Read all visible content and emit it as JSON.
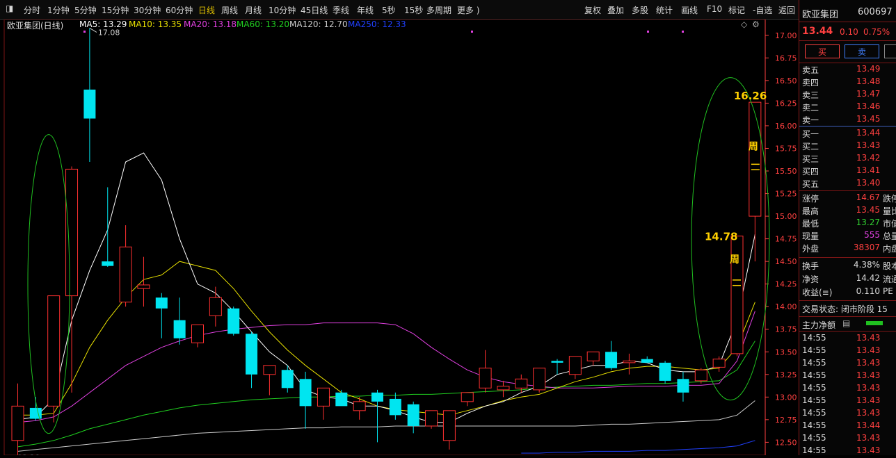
{
  "toolbar": {
    "periods": [
      "分时",
      "1分钟",
      "5分钟",
      "15分钟",
      "30分钟",
      "60分钟",
      "日线",
      "周线",
      "月线",
      "10分钟",
      "45日线",
      "季线",
      "年线",
      "5秒",
      "15秒",
      "多周期",
      "更多 )"
    ],
    "active": "日线",
    "tools": [
      "复权",
      "叠加",
      "多股",
      "统计",
      "画线",
      "F10",
      "标记",
      "-自选",
      "返回"
    ]
  },
  "chart_title": "欧亚集团(日线)",
  "ma_legend": [
    {
      "label": "MA5: 13.29",
      "color": "#ffffff"
    },
    {
      "label": "MA10: 13.35",
      "color": "#e8e000"
    },
    {
      "label": "MA20: 13.18",
      "color": "#e040e0"
    },
    {
      "label": "MA60: 13.20",
      "color": "#20d020"
    },
    {
      "label": "MA120: 12.70",
      "color": "#cccccc"
    },
    {
      "label": "MA250: 12.33",
      "color": "#2040ff"
    }
  ],
  "colors": {
    "up": "#ff3030",
    "down": "#00e5f0",
    "axis": "#ff4040",
    "ma5": "#ffffff",
    "ma10": "#e8e000",
    "ma20": "#e040e0",
    "ma60": "#20d020",
    "ma120": "#cccccc",
    "ma250": "#2040ff",
    "ellipse": "#20c020",
    "label": "#ffd000"
  },
  "chart_data": {
    "type": "candlestick",
    "title": "欧亚集团(日线)",
    "ylim": [
      12.38,
      17.16
    ],
    "yticks": [
      "17.00",
      "16.75",
      "16.50",
      "16.25",
      "16.00",
      "15.75",
      "15.50",
      "15.25",
      "15.00",
      "14.75",
      "14.50",
      "14.25",
      "14.00",
      "13.75",
      "13.50",
      "13.25",
      "13.00",
      "12.75",
      "12.50"
    ],
    "candles": [
      {
        "o": 12.52,
        "h": 13.15,
        "l": 12.36,
        "c": 12.9
      },
      {
        "o": 12.88,
        "h": 13.0,
        "l": 12.74,
        "c": 12.76
      },
      {
        "o": 12.9,
        "h": 13.0,
        "l": 12.72,
        "c": 14.12
      },
      {
        "o": 14.12,
        "h": 15.55,
        "l": 13.05,
        "c": 15.52
      },
      {
        "o": 16.4,
        "h": 17.08,
        "l": 15.6,
        "c": 16.08
      },
      {
        "o": 14.5,
        "h": 15.32,
        "l": 14.44,
        "c": 14.45
      },
      {
        "o": 14.05,
        "h": 14.9,
        "l": 14.0,
        "c": 14.66
      },
      {
        "o": 14.2,
        "h": 14.55,
        "l": 14.0,
        "c": 14.24
      },
      {
        "o": 14.1,
        "h": 14.15,
        "l": 13.65,
        "c": 13.98
      },
      {
        "o": 13.85,
        "h": 14.1,
        "l": 13.58,
        "c": 13.65
      },
      {
        "o": 13.6,
        "h": 13.8,
        "l": 13.55,
        "c": 13.8
      },
      {
        "o": 13.9,
        "h": 14.22,
        "l": 13.78,
        "c": 14.1
      },
      {
        "o": 13.98,
        "h": 14.0,
        "l": 13.68,
        "c": 13.7
      },
      {
        "o": 13.7,
        "h": 13.72,
        "l": 13.1,
        "c": 13.25
      },
      {
        "o": 13.25,
        "h": 13.3,
        "l": 13.02,
        "c": 13.35
      },
      {
        "o": 13.3,
        "h": 13.35,
        "l": 13.05,
        "c": 13.1
      },
      {
        "o": 13.2,
        "h": 13.28,
        "l": 12.65,
        "c": 12.9
      },
      {
        "o": 12.9,
        "h": 13.1,
        "l": 12.75,
        "c": 13.1
      },
      {
        "o": 13.05,
        "h": 13.08,
        "l": 12.92,
        "c": 12.9
      },
      {
        "o": 12.85,
        "h": 13.0,
        "l": 12.75,
        "c": 12.95
      },
      {
        "o": 13.05,
        "h": 13.08,
        "l": 12.5,
        "c": 12.95
      },
      {
        "o": 12.98,
        "h": 13.05,
        "l": 12.75,
        "c": 12.8
      },
      {
        "o": 12.92,
        "h": 12.95,
        "l": 12.6,
        "c": 12.68
      },
      {
        "o": 12.68,
        "h": 12.85,
        "l": 12.65,
        "c": 12.85
      },
      {
        "o": 12.52,
        "h": 12.85,
        "l": 12.42,
        "c": 12.85
      },
      {
        "o": 12.95,
        "h": 13.05,
        "l": 12.9,
        "c": 13.05
      },
      {
        "o": 13.1,
        "h": 13.52,
        "l": 13.05,
        "c": 13.32
      },
      {
        "o": 13.08,
        "h": 13.18,
        "l": 13.0,
        "c": 13.12
      },
      {
        "o": 13.1,
        "h": 13.25,
        "l": 13.05,
        "c": 13.2
      },
      {
        "o": 13.08,
        "h": 13.3,
        "l": 13.05,
        "c": 13.32
      },
      {
        "o": 13.4,
        "h": 13.42,
        "l": 13.25,
        "c": 13.38
      },
      {
        "o": 13.25,
        "h": 13.45,
        "l": 13.2,
        "c": 13.45
      },
      {
        "o": 13.4,
        "h": 13.5,
        "l": 13.35,
        "c": 13.5
      },
      {
        "o": 13.5,
        "h": 13.62,
        "l": 13.3,
        "c": 13.32
      },
      {
        "o": 13.38,
        "h": 13.48,
        "l": 13.25,
        "c": 13.4
      },
      {
        "o": 13.42,
        "h": 13.45,
        "l": 13.38,
        "c": 13.38
      },
      {
        "o": 13.38,
        "h": 13.4,
        "l": 13.15,
        "c": 13.18
      },
      {
        "o": 13.2,
        "h": 13.28,
        "l": 12.95,
        "c": 13.05
      },
      {
        "o": 13.18,
        "h": 13.32,
        "l": 13.15,
        "c": 13.3
      },
      {
        "o": 13.33,
        "h": 13.45,
        "l": 13.28,
        "c": 13.42
      },
      {
        "o": 13.48,
        "h": 14.78,
        "l": 13.45,
        "c": 14.78
      },
      {
        "o": 15.0,
        "h": 16.26,
        "l": 14.5,
        "c": 16.26
      }
    ],
    "ma": {
      "ma5": [
        12.75,
        12.78,
        12.98,
        13.85,
        14.4,
        14.85,
        15.6,
        15.7,
        15.4,
        14.75,
        14.25,
        14.15,
        13.95,
        13.72,
        13.5,
        13.35,
        13.08,
        13.0,
        12.98,
        12.9,
        12.9,
        12.85,
        12.78,
        12.72,
        12.72,
        12.82,
        12.9,
        12.95,
        13.05,
        13.12,
        13.25,
        13.3,
        13.35,
        13.35,
        13.4,
        13.38,
        13.3,
        13.28,
        13.28,
        13.35,
        13.85,
        14.8
      ],
      "ma10": [
        12.8,
        12.8,
        12.82,
        13.15,
        13.55,
        13.85,
        14.1,
        14.3,
        14.35,
        14.5,
        14.45,
        14.4,
        14.2,
        13.95,
        13.72,
        13.52,
        13.35,
        13.2,
        13.05,
        12.98,
        12.9,
        12.86,
        12.84,
        12.82,
        12.8,
        12.85,
        12.9,
        12.96,
        13.0,
        13.03,
        13.1,
        13.17,
        13.22,
        13.28,
        13.32,
        13.34,
        13.34,
        13.32,
        13.3,
        13.32,
        13.55,
        14.05
      ],
      "ma20": [
        12.72,
        12.74,
        12.78,
        12.9,
        13.05,
        13.2,
        13.35,
        13.45,
        13.55,
        13.62,
        13.68,
        13.72,
        13.75,
        13.77,
        13.79,
        13.8,
        13.8,
        13.82,
        13.82,
        13.82,
        13.82,
        13.8,
        13.7,
        13.55,
        13.42,
        13.3,
        13.22,
        13.17,
        13.14,
        13.12,
        13.1,
        13.1,
        13.1,
        13.11,
        13.12,
        13.12,
        13.12,
        13.13,
        13.13,
        13.15,
        13.4,
        13.95
      ],
      "ma60": [
        12.45,
        12.48,
        12.52,
        12.58,
        12.65,
        12.7,
        12.75,
        12.8,
        12.84,
        12.88,
        12.91,
        12.93,
        12.95,
        12.97,
        12.98,
        12.99,
        13.0,
        13.0,
        13.01,
        13.01,
        13.02,
        13.02,
        13.03,
        13.03,
        13.04,
        13.05,
        13.06,
        13.07,
        13.08,
        13.1,
        13.11,
        13.12,
        13.13,
        13.13,
        13.14,
        13.15,
        13.15,
        13.16,
        13.17,
        13.18,
        13.3,
        13.62
      ],
      "ma120": [
        12.4,
        12.42,
        12.44,
        12.46,
        12.48,
        12.5,
        12.52,
        12.54,
        12.56,
        12.58,
        12.6,
        12.61,
        12.62,
        12.63,
        12.64,
        12.65,
        12.66,
        12.66,
        12.67,
        12.67,
        12.67,
        12.68,
        12.68,
        12.68,
        12.68,
        12.68,
        12.68,
        12.68,
        12.68,
        12.68,
        12.68,
        12.68,
        12.69,
        12.7,
        12.7,
        12.71,
        12.72,
        12.73,
        12.74,
        12.75,
        12.8,
        12.96
      ],
      "ma250": [
        null,
        null,
        null,
        null,
        null,
        null,
        null,
        null,
        null,
        null,
        null,
        null,
        null,
        null,
        null,
        null,
        null,
        null,
        null,
        null,
        null,
        null,
        null,
        null,
        null,
        null,
        null,
        null,
        12.38,
        12.38,
        12.39,
        12.39,
        12.4,
        12.4,
        12.4,
        12.41,
        12.41,
        12.42,
        12.43,
        12.44,
        12.46,
        12.52
      ]
    },
    "annotations": [
      {
        "text": "17.08",
        "type": "high_marker"
      },
      {
        "text": "12.36",
        "type": "low_marker"
      },
      {
        "text": "14.78",
        "type": "high_label"
      },
      {
        "text": "16.26",
        "type": "high_label"
      },
      {
        "text": "周",
        "type": "week_mark"
      },
      {
        "text": "周",
        "type": "week_mark"
      }
    ]
  },
  "panel": {
    "name": "欧亚集团",
    "code": "600697",
    "price": "13.44",
    "change": "0.10",
    "change_pct": "0.75%",
    "buy_label": "买",
    "sell_label": "卖",
    "asks": [
      {
        "label": "卖五",
        "price": "13.49"
      },
      {
        "label": "卖四",
        "price": "13.48"
      },
      {
        "label": "卖三",
        "price": "13.47"
      },
      {
        "label": "卖二",
        "price": "13.46"
      },
      {
        "label": "卖一",
        "price": "13.45"
      }
    ],
    "bids": [
      {
        "label": "买一",
        "price": "13.44"
      },
      {
        "label": "买二",
        "price": "13.43"
      },
      {
        "label": "买三",
        "price": "13.42"
      },
      {
        "label": "买四",
        "price": "13.41"
      },
      {
        "label": "买五",
        "price": "13.40"
      }
    ],
    "stats": [
      {
        "label": "涨停",
        "value": "14.67",
        "color": "#ff4040",
        "right": "跌停"
      },
      {
        "label": "最高",
        "value": "13.45",
        "color": "#ff4040",
        "right": "量比"
      },
      {
        "label": "最低",
        "value": "13.27",
        "color": "#30d030",
        "right": "市值"
      },
      {
        "label": "现量",
        "value": "555",
        "color": "#e040e0",
        "right": "总量"
      },
      {
        "label": "外盘",
        "value": "38307",
        "color": "#ff4040",
        "right": "内盘"
      }
    ],
    "stats2": [
      {
        "label": "换手",
        "value": "4.38%",
        "right": "股本"
      },
      {
        "label": "净资",
        "value": "14.42",
        "right": "流通"
      },
      {
        "label": "收益(≡)",
        "value": "0.110",
        "right": "PE"
      }
    ],
    "status": "交易状态: 闭市阶段 15",
    "flow_label": "主力净额",
    "ticks": [
      {
        "time": "14:55",
        "price": "13.43"
      },
      {
        "time": "14:55",
        "price": "13.43"
      },
      {
        "time": "14:55",
        "price": "13.43"
      },
      {
        "time": "14:55",
        "price": "13.43"
      },
      {
        "time": "14:55",
        "price": "13.43"
      },
      {
        "time": "14:55",
        "price": "13.43"
      },
      {
        "time": "14:55",
        "price": "13.43"
      },
      {
        "time": "14:55",
        "price": "13.44"
      },
      {
        "time": "14:55",
        "price": "13.43"
      },
      {
        "time": "14:55",
        "price": "13.43"
      }
    ]
  }
}
